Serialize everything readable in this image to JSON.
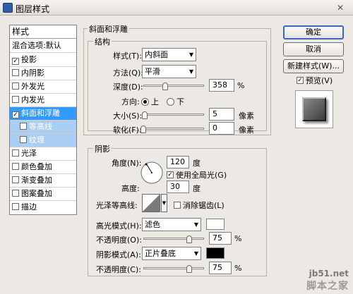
{
  "window": {
    "title": "图层样式",
    "close_glyph": "✕"
  },
  "sidebar": {
    "header": "样式",
    "blend_options": "混合选项:默认",
    "items": [
      {
        "label": "投影",
        "checked": true
      },
      {
        "label": "内阴影",
        "checked": false
      },
      {
        "label": "外发光",
        "checked": false
      },
      {
        "label": "内发光",
        "checked": false
      },
      {
        "label": "斜面和浮雕",
        "checked": true
      },
      {
        "label": "等高线",
        "checked": false
      },
      {
        "label": "纹理",
        "checked": false
      },
      {
        "label": "光泽",
        "checked": false
      },
      {
        "label": "颜色叠加",
        "checked": false
      },
      {
        "label": "渐变叠加",
        "checked": false
      },
      {
        "label": "图案叠加",
        "checked": false
      },
      {
        "label": "描边",
        "checked": false
      }
    ]
  },
  "bevel": {
    "group_title": "斜面和浮雕",
    "structure_title": "结构",
    "style_label": "样式(T):",
    "style_value": "内斜面",
    "method_label": "方法(Q):",
    "method_value": "平滑",
    "depth_label": "深度(D):",
    "depth_value": "358",
    "depth_unit": "%",
    "depth_level": 0.36,
    "direction_label": "方向:",
    "dir_up": "上",
    "dir_down": "下",
    "size_label": "大小(S):",
    "size_value": "5",
    "size_unit": "像素",
    "size_level": 0.02,
    "soften_label": "软化(F):",
    "soften_value": "0",
    "soften_unit": "像素",
    "soften_level": 0
  },
  "shading": {
    "title": "阴影",
    "angle_label": "角度(N):",
    "angle_value": "120",
    "angle_unit": "度",
    "global_light_label": "使用全局光(G)",
    "global_light_checked": true,
    "altitude_label": "高度:",
    "altitude_value": "30",
    "altitude_unit": "度",
    "gloss_contour_label": "光泽等高线:",
    "anti_alias_label": "消除锯齿(L)",
    "highlight_mode_label": "高光模式(H):",
    "highlight_mode_value": "滤色",
    "highlight_color": "#ffffff",
    "opacity1_label": "不透明度(O):",
    "opacity1_value": "75",
    "opacity1_unit": "%",
    "opacity1_level": 0.75,
    "shadow_mode_label": "阴影模式(A):",
    "shadow_mode_value": "正片叠底",
    "shadow_color": "#000000",
    "opacity2_label": "不透明度(C):",
    "opacity2_value": "75",
    "opacity2_unit": "%",
    "opacity2_level": 0.75
  },
  "buttons": {
    "ok": "确定",
    "cancel": "取消",
    "new_style": "新建样式(W)...",
    "preview_label": "预览(V)",
    "preview_checked": true
  },
  "watermark": {
    "url": "jb51.net",
    "name": "脚本之家"
  }
}
